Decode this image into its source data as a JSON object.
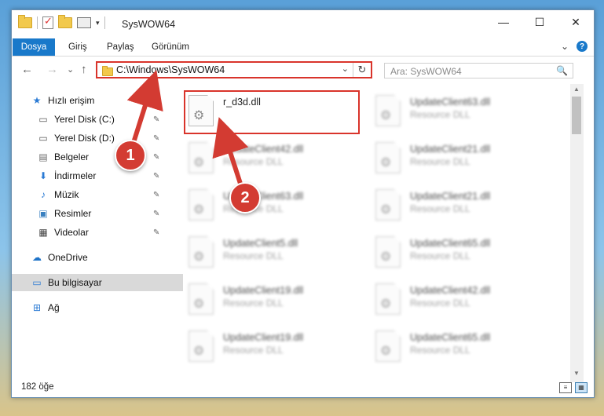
{
  "window": {
    "title": "SysWOW64",
    "controls": {
      "minimize": "—",
      "maximize": "☐",
      "close": "✕"
    }
  },
  "ribbon": {
    "tabs": [
      "Dosya",
      "Giriş",
      "Paylaş",
      "Görünüm"
    ],
    "expand_icon": "⌄",
    "help": "?"
  },
  "nav": {
    "back": "←",
    "forward": "→",
    "recent": "⌄",
    "up": "↑",
    "address": "C:\\Windows\\SysWOW64",
    "address_dropdown": "⌄",
    "refresh": "↻",
    "search_placeholder": "Ara: SysWOW64",
    "search_icon": "🔍"
  },
  "sidebar": {
    "items": [
      {
        "label": "Hızlı erişim",
        "icon": "★"
      },
      {
        "label": "Yerel Disk (C:)",
        "icon": "▭"
      },
      {
        "label": "Yerel Disk (D:)",
        "icon": "▭"
      },
      {
        "label": "Belgeler",
        "icon": "▤"
      },
      {
        "label": "İndirmeler",
        "icon": "⬇"
      },
      {
        "label": "Müzik",
        "icon": "♪"
      },
      {
        "label": "Resimler",
        "icon": "▣"
      },
      {
        "label": "Videolar",
        "icon": "▦"
      },
      {
        "label": "OneDrive",
        "icon": "☁"
      },
      {
        "label": "Bu bilgisayar",
        "icon": "▭"
      },
      {
        "label": "Ağ",
        "icon": "⊞"
      }
    ],
    "pin_icon": "✎"
  },
  "files": {
    "col1": [
      {
        "name": "r_d3d.dll",
        "type": ""
      },
      {
        "name": "UpdateClient42.dll",
        "type": "Resource DLL"
      },
      {
        "name": "UpdateClient63.dll",
        "type": "Resource DLL"
      },
      {
        "name": "UpdateClient5.dll",
        "type": "Resource DLL"
      },
      {
        "name": "UpdateClient19.dll",
        "type": "Resource DLL"
      },
      {
        "name": "UpdateClient19.dll",
        "type": "Resource DLL"
      }
    ],
    "col2": [
      {
        "name": "UpdateClient63.dll",
        "type": "Resource DLL"
      },
      {
        "name": "UpdateClient21.dll",
        "type": "Resource DLL"
      },
      {
        "name": "UpdateClient21.dll",
        "type": "Resource DLL"
      },
      {
        "name": "UpdateClient65.dll",
        "type": "Resource DLL"
      },
      {
        "name": "UpdateClient42.dll",
        "type": "Resource DLL"
      },
      {
        "name": "UpdateClient65.dll",
        "type": "Resource DLL"
      }
    ],
    "gear_icon": "⚙"
  },
  "status": {
    "count": "182 öğe",
    "view_details": "≡",
    "view_icons": "▦"
  },
  "annotations": {
    "step1": "1",
    "step2": "2"
  }
}
